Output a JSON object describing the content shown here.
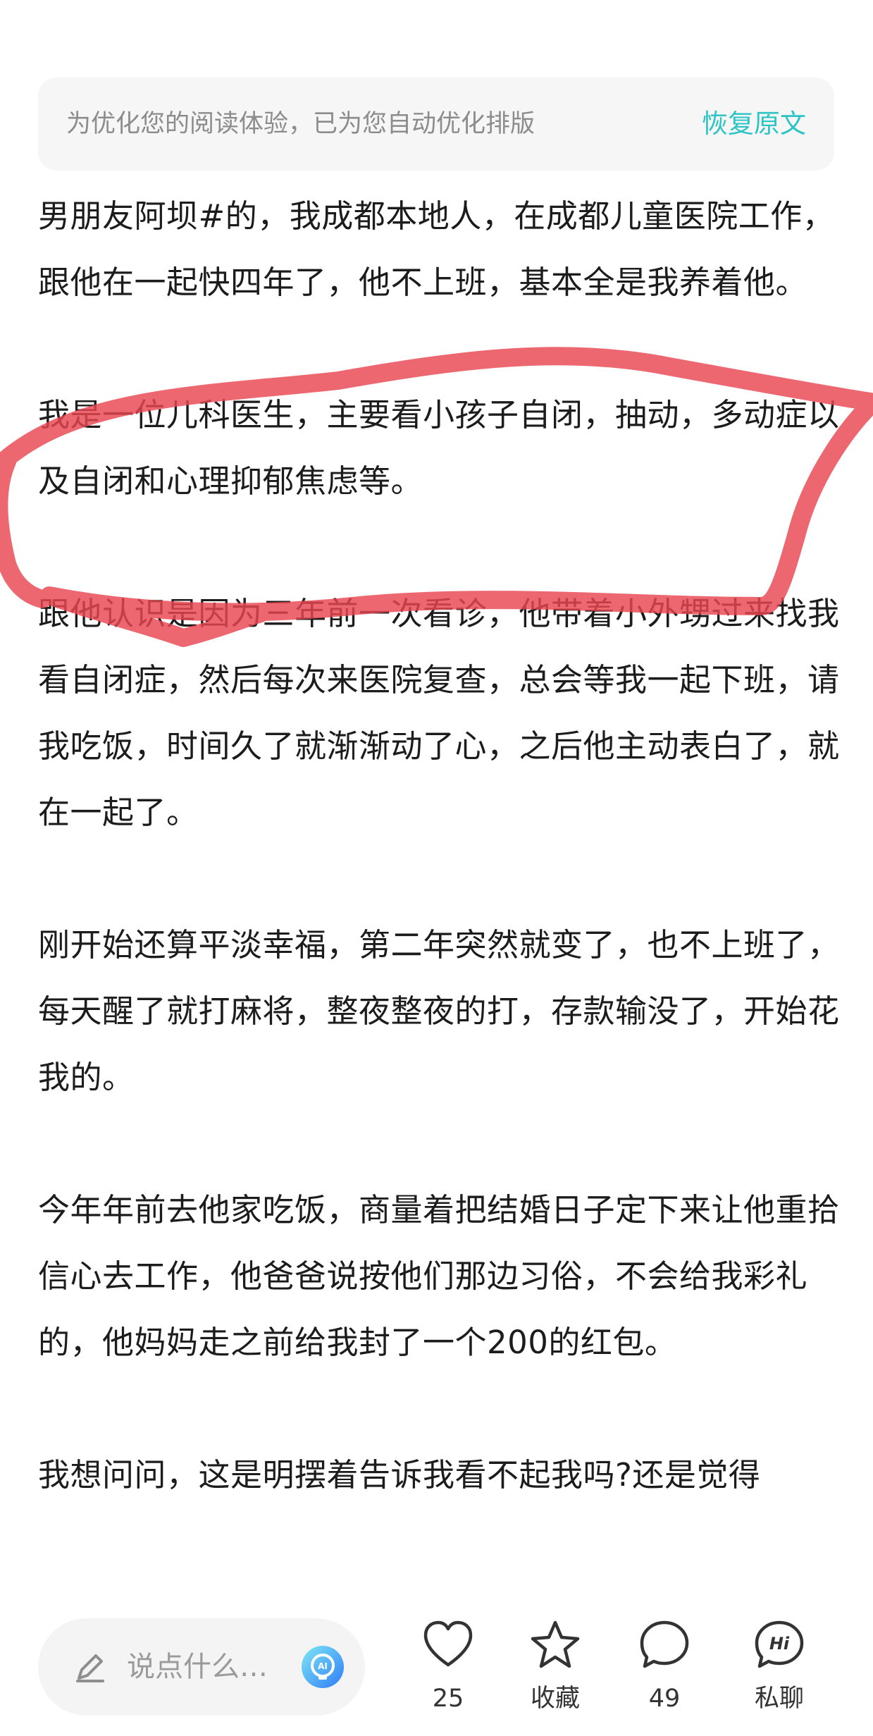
{
  "banner": {
    "text": "为优化您的阅读体验，已为您自动优化排版",
    "action_label": "恢复原文"
  },
  "article": {
    "paragraphs": [
      "男朋友阿坝#的，我成都本地人，在成都儿童医院工作，跟他在一起快四年了，他不上班，基本全是我养着他。",
      "我是一位儿科医生，主要看小孩子自闭，抽动，多动症以及自闭和心理抑郁焦虑等。",
      "跟他认识是因为三年前一次看诊，他带着小外甥过来找我看自闭症，然后每次来医院复查，总会等我一起下班，请我吃饭，时间久了就渐渐动了心，之后他主动表白了，就在一起了。",
      "刚开始还算平淡幸福，第二年突然就变了，也不上班了，每天醒了就打麻将，整夜整夜的打，存款输没了，开始花我的。",
      "今年年前去他家吃饭，商量着把结婚日子定下来让他重拾信心去工作，他爸爸说按他们那边习俗，不会给我彩礼的，他妈妈走之前给我封了一个200的红包。",
      "我想问问，这是明摆着告诉我看不起我吗?还是觉得"
    ]
  },
  "annotation": {
    "color": "#e8464f",
    "icon": "red-highlight-circle"
  },
  "bottom_bar": {
    "comment_placeholder": "说点什么…",
    "like_count": "25",
    "favorite_label": "收藏",
    "comment_count": "49",
    "message_label": "私聊",
    "accent_color": "#2cc4c4"
  }
}
